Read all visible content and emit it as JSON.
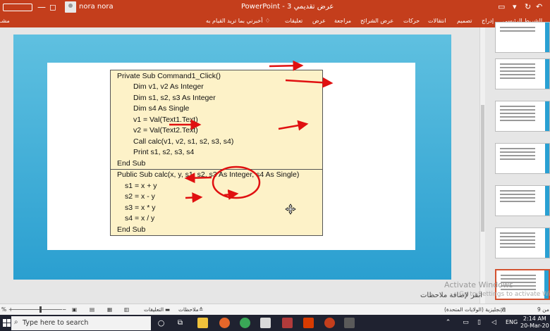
{
  "titlebar": {
    "app_title": "PowerPoint - عرض تقديمي 3",
    "user_name": "nora nora",
    "colors": {
      "accent": "#c43e1c"
    }
  },
  "ribbon": {
    "tabs": [
      "الشريط الرئيسي",
      "إدراج",
      "تصميم",
      "انتقالات",
      "حركات",
      "عرض الشرائح",
      "مراجعة",
      "عرض",
      "تعليقات"
    ],
    "tell_me": "أخبرني بما تريد القيام به",
    "share": "مشـ"
  },
  "slide": {
    "code_lines": [
      "Private Sub Command1_Click()",
      "Dim v1, v2 As Integer",
      "Dim s1, s2, s3 As Integer",
      "Dim s4 As Single",
      "v1 = Val(Text1.Text)",
      "v2 = Val(Text2.Text)",
      "Call calc(v1, v2, s1, s2, s3, s4)",
      "Print s1, s2, s3, s4",
      "End Sub",
      "Public Sub calc(x, y, s1, s2, s3 As Integer, s4 As Single)",
      "s1 = x + y",
      "s2 = x - y",
      "s3 = x * y",
      "s4 = x / y",
      "End Sub"
    ]
  },
  "notes": {
    "placeholder": "انقر لإضافة ملاحظات",
    "watermark_line1": "Activate Windows",
    "watermark_line2": "Go to Settings to activate Windows"
  },
  "statusbar": {
    "zoom": "%",
    "comments": "التعليقات",
    "notes": "ملاحظات",
    "language": "الإنجليزية (الولايات المتحدة)",
    "slide_counter": "9 من"
  },
  "taskbar": {
    "search_placeholder": "Type here to search",
    "lang": "ENG",
    "time": "2:14 AM",
    "date": "20-Mar-20"
  }
}
